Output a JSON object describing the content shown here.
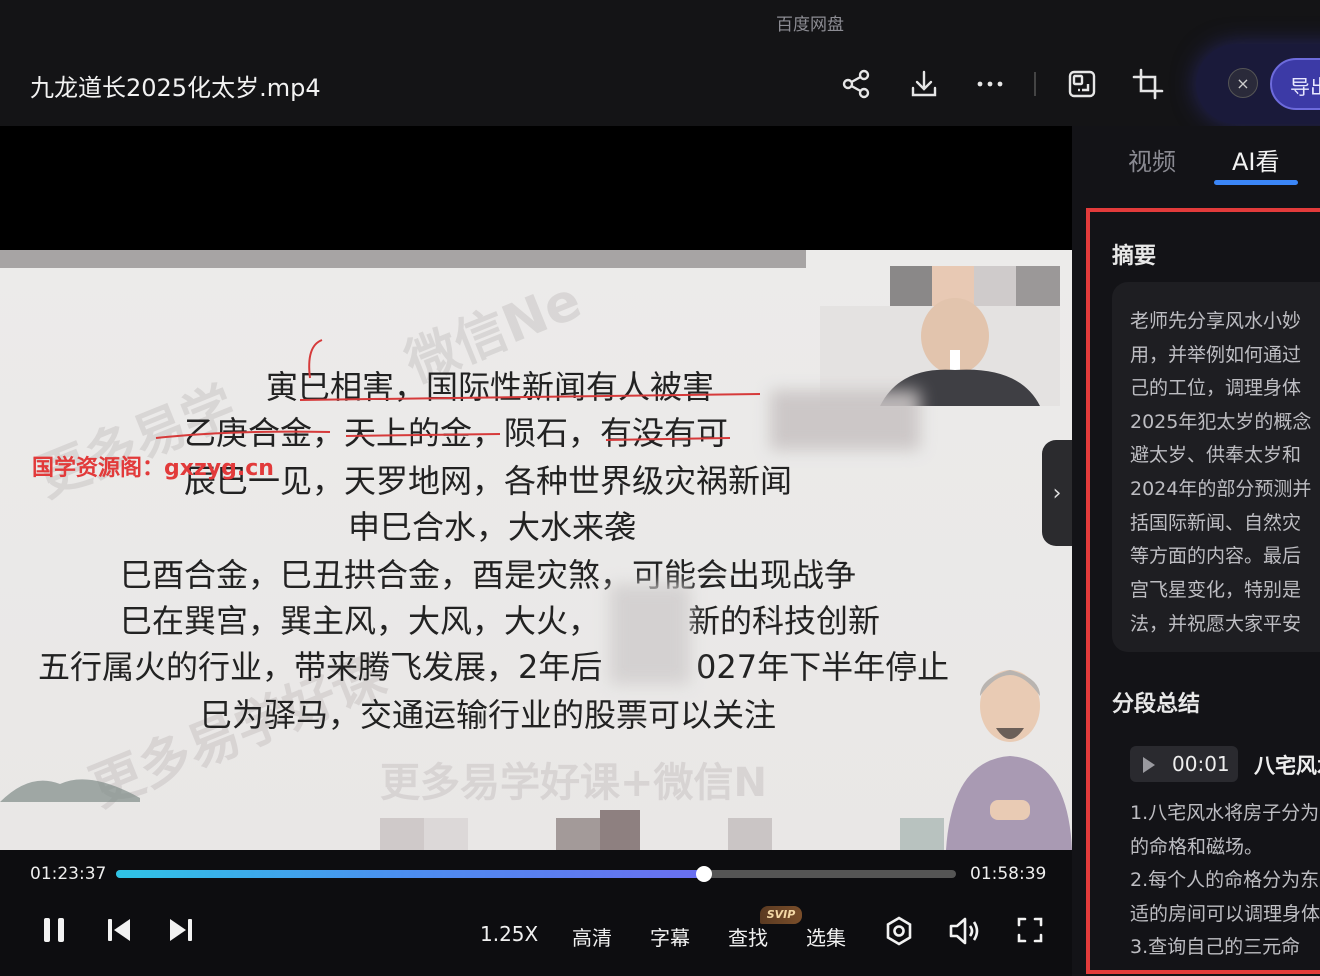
{
  "app": {
    "title": "百度网盘"
  },
  "header": {
    "file_title": "九龙道长2025化太岁.mp4",
    "export_label": "导出",
    "close_glyph": "×"
  },
  "icons": {
    "share": "share-icon",
    "download": "download-icon",
    "more": "more-icon",
    "screenshot": "screen-capture-icon",
    "crop": "crop-icon"
  },
  "slide": {
    "lines": [
      "寅巳相害，国际性新闻有人被害",
      "乙庚合金，天上的金，陨石，有没有可",
      "辰巳一见，天罗地网，各种世界级灾祸新闻",
      "申巳合水，大水来袭",
      "巳酉合金，巳丑拱合金，酉是灾煞，可能会出现战争",
      "巳在巽宫，巽主风，大风，大火，",
      "新的科技创新",
      "五行属火的行业，带来腾飞发展，2年后",
      "027年下半年停止",
      "巳为驿马，交通运输行业的股票可以关注"
    ],
    "promo": "国学资源阁：gxzyg.cn",
    "watermark_1": "更多易学",
    "watermark_2": "更多易学好课",
    "watermark_3": "更多易学好课+微信N",
    "watermark_4": "微信Ne"
  },
  "player": {
    "current_time": "01:23:37",
    "total_time": "01:58:39",
    "progress": 0.7,
    "speed_label": "1.25X",
    "quality_label": "高清",
    "subtitle_label": "字幕",
    "search_label": "查找",
    "svip_badge": "SVIP",
    "episodes_label": "选集",
    "expand_glyph": "›"
  },
  "panel": {
    "tabs": [
      {
        "label": "视频"
      },
      {
        "label": "AI看"
      }
    ],
    "summary_title": "摘要",
    "summary_lines": [
      "老师先分享风水小妙",
      "用，并举例如何通过",
      "己的工位，调理身体",
      "2025年犯太岁的概念",
      "避太岁、供奉太岁和",
      "2024年的部分预测并",
      "括国际新闻、自然灾",
      "等方面的内容。最后",
      "宫飞星变化，特别是",
      "法，并祝愿大家平安"
    ],
    "segments_title": "分段总结",
    "segment": {
      "time": "00:01",
      "title": "八宅风水",
      "lines": [
        "1.八宅风水将房子分为",
        "的命格和磁场。",
        "2.每个人的命格分为东",
        "适的房间可以调理身体",
        "3.查询自己的三元命"
      ]
    }
  },
  "colors": {
    "accent": "#3b86f7",
    "highlight_frame": "#e33b3b",
    "promo_red": "#e23a3a"
  }
}
